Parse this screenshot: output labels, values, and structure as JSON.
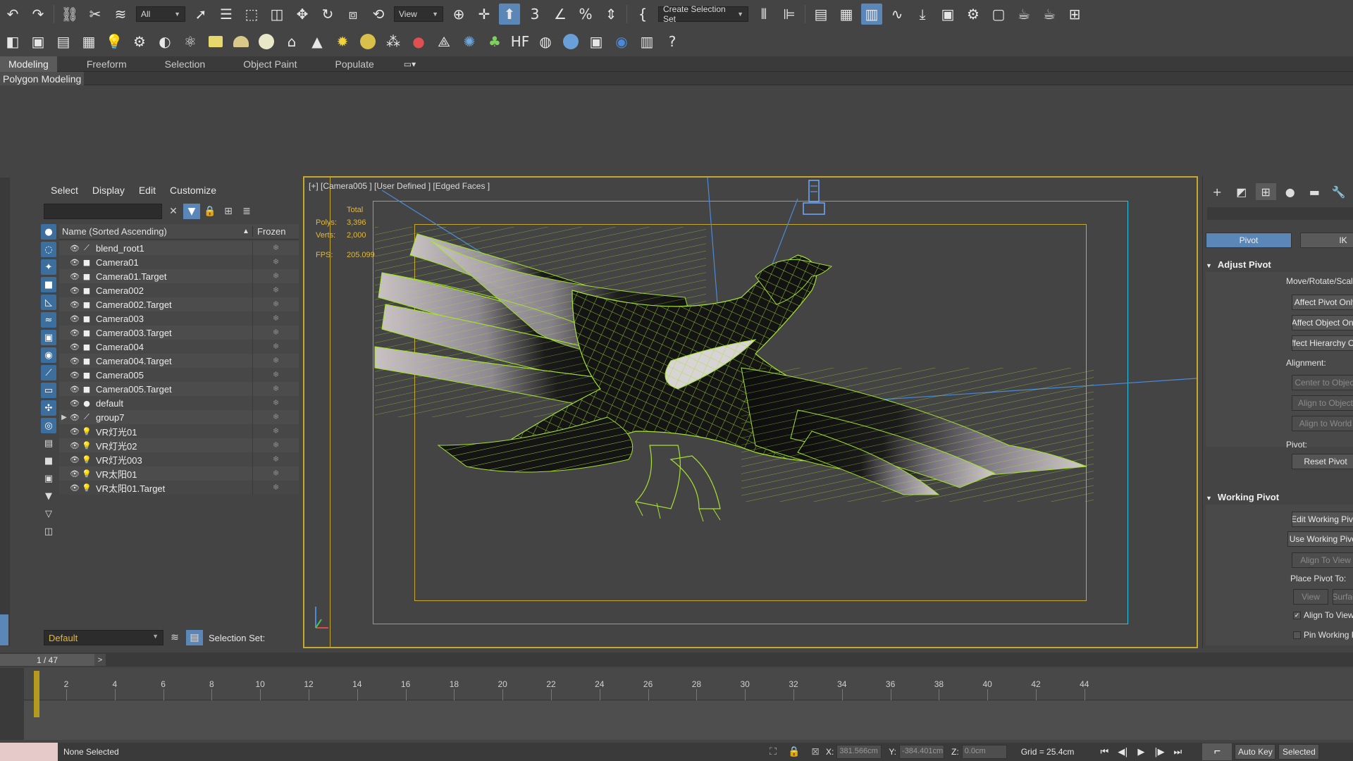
{
  "toolbar1": {
    "selection_filter": "All",
    "reference_coord": "View",
    "named_selection": "Create Selection Set"
  },
  "ribbon": {
    "tabs": [
      "Modeling",
      "Freeform",
      "Selection",
      "Object Paint",
      "Populate"
    ],
    "active_tab": "Modeling",
    "sub_label": "Polygon Modeling"
  },
  "explorer": {
    "menu": [
      "Select",
      "Display",
      "Edit",
      "Customize"
    ],
    "header": {
      "name": "Name (Sorted Ascending)",
      "frozen": "Frozen"
    },
    "rows": [
      {
        "name": "blend_root1",
        "icon": "bone-icon"
      },
      {
        "name": "Camera01",
        "icon": "camera-icon"
      },
      {
        "name": "Camera01.Target",
        "icon": "camera-icon"
      },
      {
        "name": "Camera002",
        "icon": "camera-icon"
      },
      {
        "name": "Camera002.Target",
        "icon": "camera-icon"
      },
      {
        "name": "Camera003",
        "icon": "camera-icon"
      },
      {
        "name": "Camera003.Target",
        "icon": "camera-icon"
      },
      {
        "name": "Camera004",
        "icon": "camera-icon"
      },
      {
        "name": "Camera004.Target",
        "icon": "camera-icon"
      },
      {
        "name": "Camera005",
        "icon": "camera-icon"
      },
      {
        "name": "Camera005.Target",
        "icon": "camera-icon"
      },
      {
        "name": "default",
        "icon": "geometry-icon"
      },
      {
        "name": "group7",
        "icon": "bone-icon",
        "expandable": true
      },
      {
        "name": "VR灯光01",
        "icon": "light-icon"
      },
      {
        "name": "VR灯光02",
        "icon": "light-icon"
      },
      {
        "name": "VR灯光003",
        "icon": "light-icon"
      },
      {
        "name": "VR太阳01",
        "icon": "light-icon"
      },
      {
        "name": "VR太阳01.Target",
        "icon": "light-icon"
      }
    ],
    "layer": "Default",
    "selection_set_label": "Selection Set:"
  },
  "viewport": {
    "label": "[+] [Camera005 ] [User Defined ] [Edged Faces ]",
    "stats": {
      "total_label": "Total",
      "polys_label": "Polys:",
      "polys_value": "3,396",
      "verts_label": "Verts:",
      "verts_value": "2,000",
      "fps_label": "FPS:",
      "fps_value": "205.099"
    }
  },
  "command_panel": {
    "buttons": {
      "pivot": "Pivot",
      "ik": "IK"
    },
    "adjust_pivot": {
      "title": "Adjust Pivot",
      "move_label": "Move/Rotate/Scale:",
      "affect_pivot": "Affect Pivot Only",
      "affect_object": "Affect Object Only",
      "affect_hierarchy": "Affect Hierarchy Only",
      "alignment_label": "Alignment:",
      "center_to_object": "Center to Object",
      "align_to_object": "Align to Object",
      "align_to_world": "Align to World",
      "pivot_label": "Pivot:",
      "reset_pivot": "Reset Pivot"
    },
    "working_pivot": {
      "title": "Working Pivot",
      "edit_working": "Edit Working Pivot",
      "use_working": "Use Working Pivot",
      "align_to_view": "Align To View",
      "place_pivot_label": "Place Pivot To:",
      "view_btn": "View",
      "surface_btn": "Surface",
      "align_to_view_check": "Align To View",
      "pin_working": "Pin Working Pivot"
    }
  },
  "frame": {
    "counter": "1 / 47",
    "next": ">"
  },
  "timeline": {
    "ticks": [
      2,
      4,
      6,
      8,
      10,
      12,
      14,
      16,
      18,
      20,
      22,
      24,
      26,
      28,
      30,
      32,
      34,
      36,
      38,
      40,
      42,
      44
    ],
    "current_frame": 1
  },
  "status": {
    "selection": "None Selected",
    "x_label": "X:",
    "x_value": "381.566cm",
    "y_label": "Y:",
    "y_value": "-384.401cm",
    "z_label": "Z:",
    "z_value": "0.0cm",
    "grid": "Grid = 25.4cm",
    "auto_key": "Auto Key",
    "selected": "Selected"
  },
  "colors": {
    "accent": "#5b86b8",
    "viewport_border": "#c8a82a",
    "safe_frame": "#1fc6e8",
    "stats_text": "#e2b93b",
    "wireframe": "#a6e22e"
  }
}
